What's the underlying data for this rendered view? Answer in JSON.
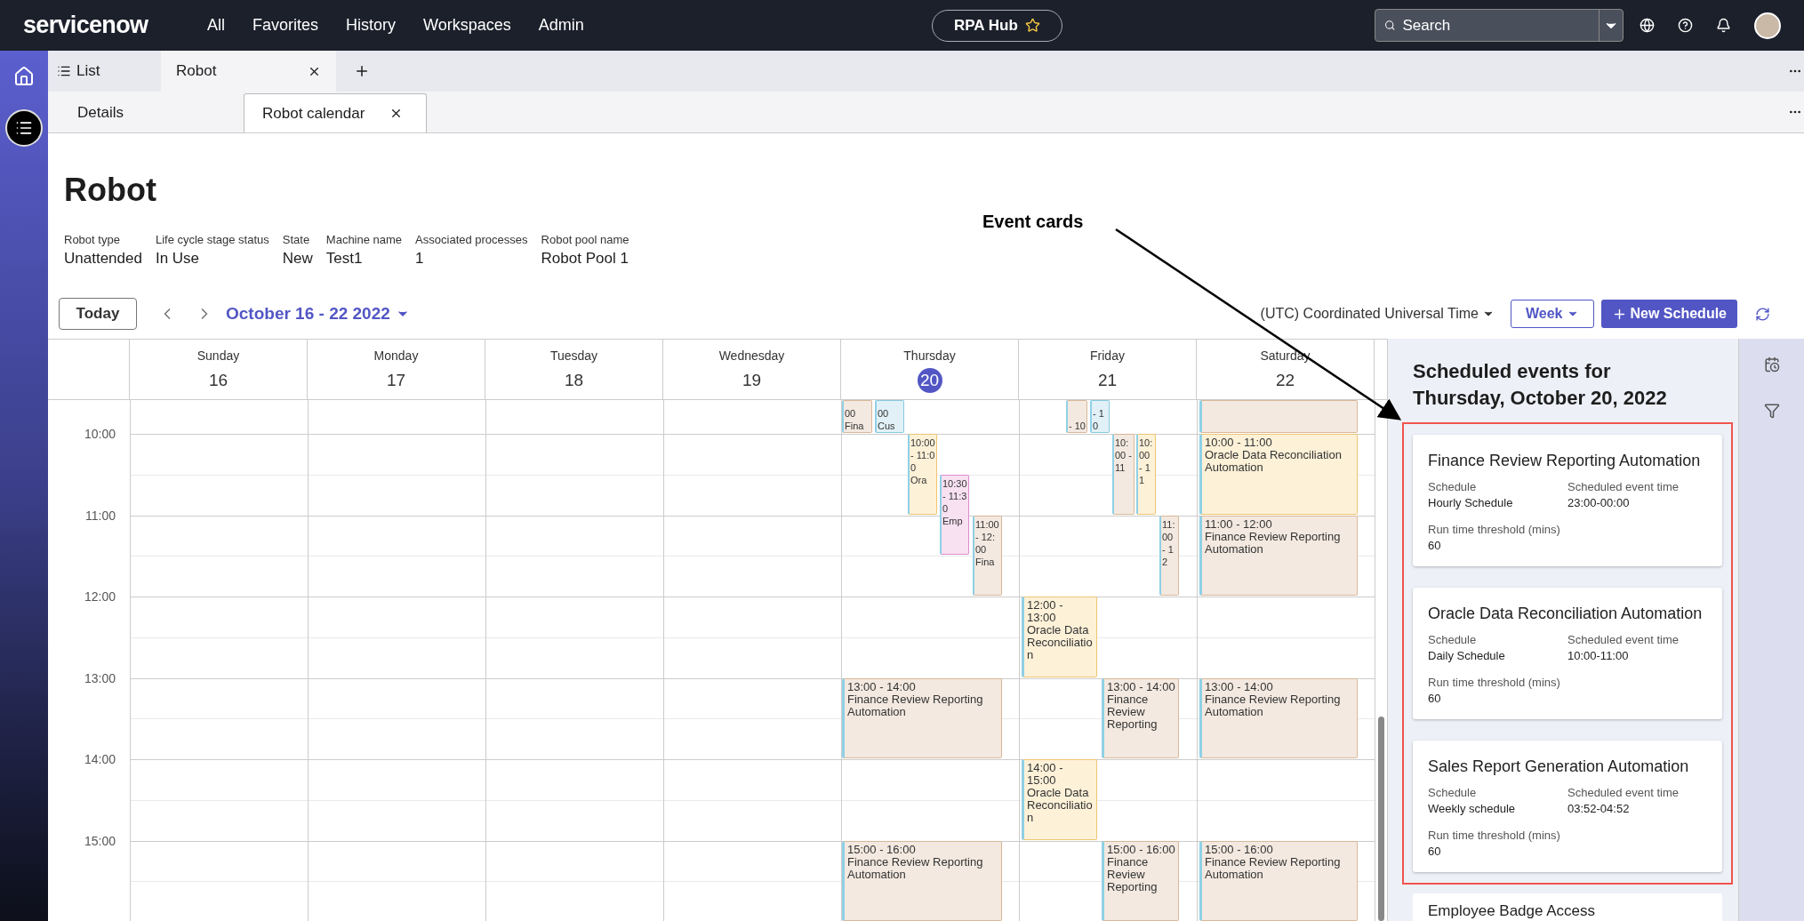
{
  "top_bar": {
    "logo": "servicenow",
    "nav": [
      "All",
      "Favorites",
      "History",
      "Workspaces",
      "Admin"
    ],
    "workspace": "RPA Hub",
    "search": {
      "placeholder": "Search"
    }
  },
  "record_tabs": [
    {
      "label": "List",
      "kind": "list",
      "selected": false
    },
    {
      "label": "Robot",
      "kind": "tab",
      "selected": true
    }
  ],
  "sub_tabs": [
    {
      "label": "Details",
      "selected": false
    },
    {
      "label": "Robot calendar",
      "selected": true
    }
  ],
  "title": "Robot",
  "fields": [
    {
      "label": "Robot type",
      "value": "Unattended"
    },
    {
      "label": "Life cycle stage status",
      "value": "In Use"
    },
    {
      "label": "State",
      "value": "New"
    },
    {
      "label": "Machine name",
      "value": "Test1"
    },
    {
      "label": "Associated processes",
      "value": "1"
    },
    {
      "label": "Robot pool name",
      "value": "Robot Pool 1"
    }
  ],
  "calendar": {
    "today": "Today",
    "range": "October 16 - 22 2022",
    "timezone": "(UTC) Coordinated Universal Time",
    "view": "Week",
    "new_schedule": "New Schedule",
    "hours": [
      "10:00",
      "11:00",
      "12:00",
      "13:00",
      "14:00",
      "15:00"
    ],
    "days": [
      {
        "name": "Sunday",
        "date": "16",
        "selected": false
      },
      {
        "name": "Monday",
        "date": "17",
        "selected": false
      },
      {
        "name": "Tuesday",
        "date": "18",
        "selected": false
      },
      {
        "name": "Wednesday",
        "date": "19",
        "selected": false
      },
      {
        "name": "Thursday",
        "date": "20",
        "selected": true,
        "events": [
          {
            "time": "00",
            "title": "Fina",
            "color": "#f3e9e0"
          },
          {
            "time": "00",
            "title": "Cus",
            "color": "#e1f1f7"
          },
          {
            "time": "10:00 - 11:00",
            "title": "Ora",
            "color": "#fdf1d8"
          },
          {
            "time": "10:30 - 11:30",
            "title": "Emp",
            "color": "#f8e1f1"
          },
          {
            "time": "11:00 - 12:00",
            "title": "Fina",
            "color": "#f3e9e0"
          },
          {
            "time": "13:00 - 14:00",
            "title": "Finance Review Reporting Automation",
            "color": "#f3e9e0"
          },
          {
            "time": "15:00 - 16:00",
            "title": "Finance Review Reporting Automation",
            "color": "#f3e9e0"
          }
        ]
      },
      {
        "name": "Friday",
        "date": "21",
        "selected": false,
        "events": [
          {
            "time": "- 10",
            "color": "#f3e9e0"
          },
          {
            "time": "- 10",
            "color": "#e1f1f7"
          },
          {
            "time": "10:00 - 11",
            "color": "#f3e9e0"
          },
          {
            "time": "10:00 - 11",
            "color": "#fdf1d8"
          },
          {
            "time": "11:00 - 12",
            "color": "#f3e9e0"
          },
          {
            "time": "12:00 - 13:00",
            "title": "Oracle Data Reconciliation",
            "color": "#fdf1d8"
          },
          {
            "time": "13:00 - 14:00",
            "title": "Finance Review Reporting",
            "color": "#f3e9e0"
          },
          {
            "time": "14:00 - 15:00",
            "title": "Oracle Data Reconciliation",
            "color": "#fdf1d8"
          },
          {
            "time": "15:00 - 16:00",
            "title": "Finance Review Reporting",
            "color": "#f3e9e0"
          }
        ]
      },
      {
        "name": "Saturday",
        "date": "22",
        "selected": false,
        "events": [
          {
            "color": "#f3e9e0"
          },
          {
            "time": "10:00 - 11:00",
            "title": "Oracle Data Reconciliation Automation",
            "color": "#fdf1d8"
          },
          {
            "time": "11:00 - 12:00",
            "title": "Finance Review Reporting Automation",
            "color": "#f3e9e0"
          },
          {
            "time": "13:00 - 14:00",
            "title": "Finance Review Reporting Automation",
            "color": "#f3e9e0"
          },
          {
            "time": "15:00 - 16:00",
            "title": "Finance Review Reporting Automation",
            "color": "#f3e9e0"
          }
        ]
      }
    ]
  },
  "panel": {
    "title": "Scheduled events for Thursday, October 20, 2022",
    "cards": [
      {
        "title": "Finance Review Reporting Automation",
        "fields": [
          {
            "label": "Schedule",
            "value": "Hourly Schedule"
          },
          {
            "label": "Scheduled event time",
            "value": "23:00-00:00"
          },
          {
            "label": "Run time threshold (mins)",
            "value": "60"
          }
        ]
      },
      {
        "title": "Oracle Data Reconciliation Automation",
        "fields": [
          {
            "label": "Schedule",
            "value": "Daily Schedule"
          },
          {
            "label": "Scheduled event time",
            "value": "10:00-11:00"
          },
          {
            "label": "Run time threshold (mins)",
            "value": "60"
          }
        ]
      },
      {
        "title": "Sales Report Generation Automation",
        "fields": [
          {
            "label": "Schedule",
            "value": "Weekly schedule"
          },
          {
            "label": "Scheduled event time",
            "value": "03:52-04:52"
          },
          {
            "label": "Run time threshold (mins)",
            "value": "60"
          }
        ]
      }
    ],
    "partial_card": "Employee Badge Access"
  },
  "annotation": {
    "label": "Event cards"
  }
}
